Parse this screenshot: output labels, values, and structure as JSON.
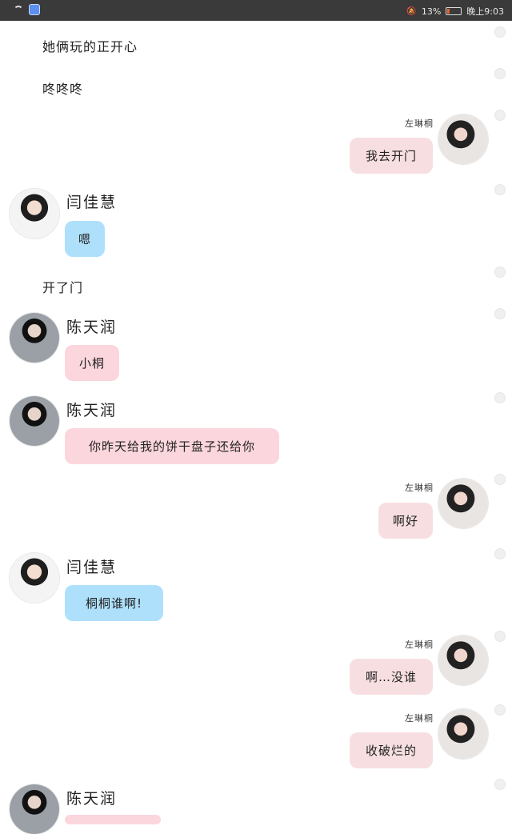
{
  "status_bar": {
    "battery_percent": "13%",
    "time": "晚上9:03"
  },
  "messages": [
    {
      "type": "narration",
      "text": "她俩玩的正开心"
    },
    {
      "type": "narration",
      "text": "咚咚咚"
    },
    {
      "type": "right",
      "sender": "左琳桐",
      "text": "我去开门"
    },
    {
      "type": "left",
      "sender": "闫佳慧",
      "text": "嗯"
    },
    {
      "type": "narration",
      "text": "开了门"
    },
    {
      "type": "left",
      "sender": "陈天润",
      "text": "小桐"
    },
    {
      "type": "left",
      "sender": "陈天润",
      "text": "你昨天给我的饼干盘子还给你"
    },
    {
      "type": "right",
      "sender": "左琳桐",
      "text": "啊好"
    },
    {
      "type": "left",
      "sender": "闫佳慧",
      "text": "桐桐谁啊!"
    },
    {
      "type": "right",
      "sender": "左琳桐",
      "text": "啊…没谁"
    },
    {
      "type": "right",
      "sender": "左琳桐",
      "text": "收破烂的"
    },
    {
      "type": "left",
      "sender": "陈天润",
      "text": ""
    }
  ],
  "colors": {
    "bubble_blue": "#aee0fb",
    "bubble_pink": "#fbd6dd",
    "bubble_right": "#f7dfe1",
    "status_bar": "#3a3a3a"
  }
}
